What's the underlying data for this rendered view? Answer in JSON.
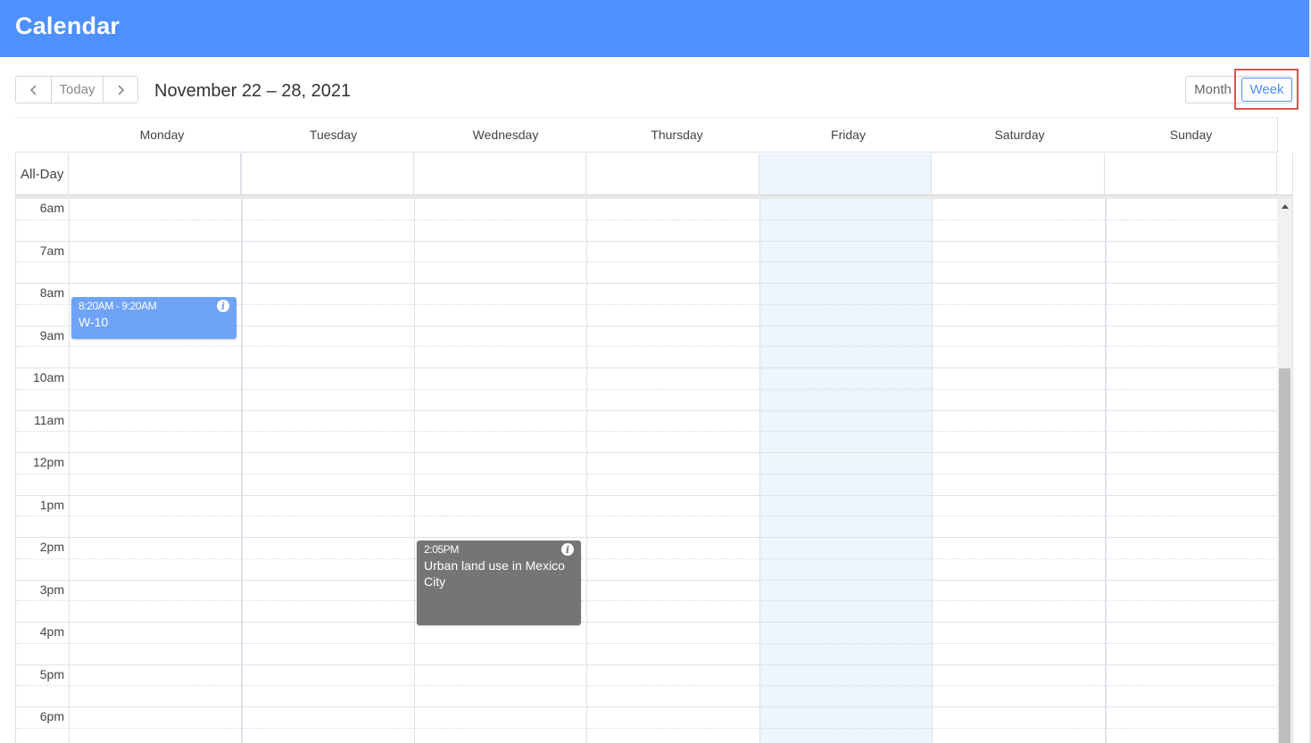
{
  "app": {
    "title": "Calendar"
  },
  "toolbar": {
    "prev_icon": "chevron-left-icon",
    "today_label": "Today",
    "next_icon": "chevron-right-icon",
    "date_range": "November 22 – 28, 2021",
    "views": {
      "month_label": "Month",
      "week_label": "Week",
      "active": "Week"
    }
  },
  "week": {
    "days": [
      "Monday",
      "Tuesday",
      "Wednesday",
      "Thursday",
      "Friday",
      "Saturday",
      "Sunday"
    ],
    "highlighted_day": "Friday",
    "all_day_label": "All-Day",
    "hours": [
      "6am",
      "7am",
      "8am",
      "9am",
      "10am",
      "11am",
      "12pm",
      "1pm",
      "2pm",
      "3pm",
      "4pm",
      "5pm",
      "6pm"
    ]
  },
  "events": [
    {
      "day": "Monday",
      "time": "8:20AM - 9:20AM",
      "title": "W-10",
      "color": "#6ea3f7",
      "icon": "info-icon"
    },
    {
      "day": "Wednesday",
      "time": "2:05PM",
      "title": "Urban land use in Mexico City",
      "color": "#757575",
      "icon": "info-icon"
    }
  ],
  "colors": {
    "header": "#4d90fe",
    "accent": "#4d90fe",
    "today_column": "#eef5fe",
    "highlight": "#d9534f"
  }
}
